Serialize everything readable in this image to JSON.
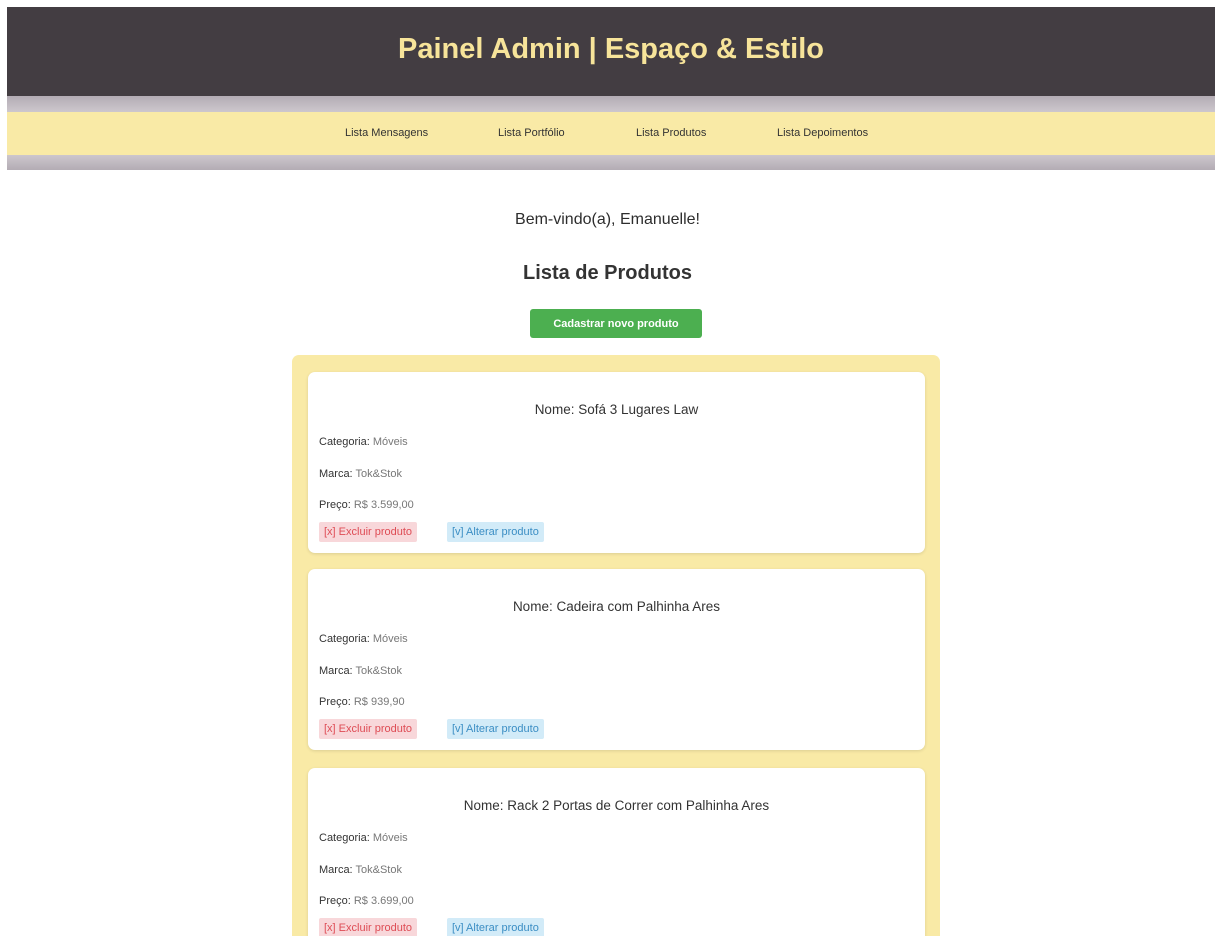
{
  "header": {
    "title": "Painel Admin | Espaço & Estilo",
    "bg_color": "#433d42",
    "title_color": "#f7e49a"
  },
  "nav": {
    "items": [
      {
        "label": "Lista Mensagens"
      },
      {
        "label": "Lista Portfólio"
      },
      {
        "label": "Lista Produtos"
      },
      {
        "label": "Lista Depoimentos"
      }
    ],
    "bg_color": "#f9eaa6"
  },
  "main": {
    "welcome": "Bem-vindo(a), Emanuelle!",
    "title": "Lista de Produtos",
    "new_button": "Cadastrar novo produto",
    "accent_color": "#4caf50"
  },
  "field_labels": {
    "category": "Categoria:",
    "brand": "Marca:",
    "price": "Preço:"
  },
  "actions": {
    "delete": "[x] Excluir produto",
    "edit": "[v] Alterar produto"
  },
  "products": [
    {
      "name": "Nome: Sofá 3 Lugares Law",
      "category": "Móveis",
      "brand": "Tok&Stok",
      "price": "R$ 3.599,00"
    },
    {
      "name": "Nome: Cadeira com Palhinha Ares",
      "category": "Móveis",
      "brand": "Tok&Stok",
      "price": "R$ 939,90"
    },
    {
      "name": "Nome: Rack 2 Portas de Correr com Palhinha Ares",
      "category": "Móveis",
      "brand": "Tok&Stok",
      "price": "R$ 3.699,00"
    }
  ]
}
